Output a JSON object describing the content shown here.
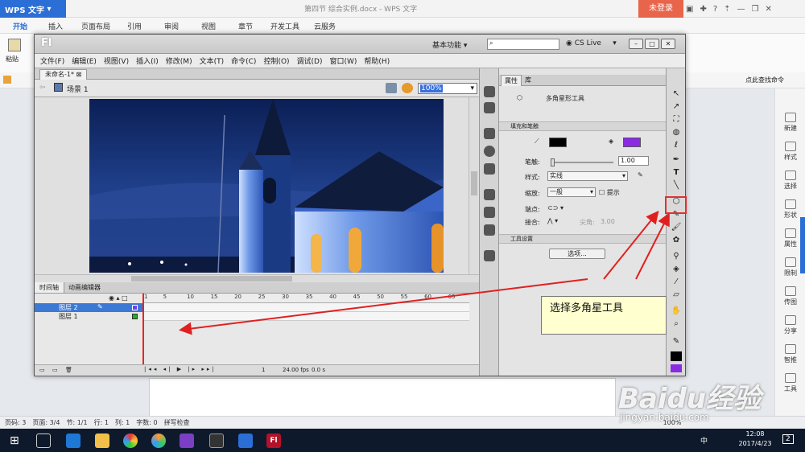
{
  "wps": {
    "app_name": "WPS 文字",
    "doc_title": "第四节  综合实例.docx - WPS 文字",
    "login": "未登录",
    "tabs": [
      "开始",
      "插入",
      "页面布局",
      "引用",
      "审阅",
      "视图",
      "章节",
      "开发工具",
      "云服务"
    ],
    "paste_label": "粘贴",
    "search_cmd": "点此查找命令",
    "sidebar": [
      "新建",
      "样式",
      "选择",
      "形状",
      "属性",
      "限制",
      "传图",
      "分享",
      "智推",
      "工具"
    ],
    "status": {
      "page": "页码: 3",
      "pages": "页面: 3/4",
      "section": "节: 1/1",
      "row": "行: 1",
      "col": "列: 1",
      "words": "字数: 0",
      "spell": "拼写检查",
      "zoom": "100%"
    }
  },
  "taskbar": {
    "time": "12:08",
    "date": "2017/4/23",
    "ime": "中",
    "notif": "2"
  },
  "flash": {
    "logo": "Fl",
    "workspace": "基本功能",
    "cslive": "CS Live",
    "menu": [
      "文件(F)",
      "编辑(E)",
      "视图(V)",
      "插入(I)",
      "修改(M)",
      "文本(T)",
      "命令(C)",
      "控制(O)",
      "调试(D)",
      "窗口(W)",
      "帮助(H)"
    ],
    "doc_tab": "未命名-1*",
    "scene": "场景 1",
    "zoom": "100%",
    "timeline_tabs": [
      "时间轴",
      "动画编辑器"
    ],
    "frame_ticks": [
      "1",
      "5",
      "10",
      "15",
      "20",
      "25",
      "30",
      "35",
      "40",
      "45",
      "50",
      "55",
      "60",
      "65"
    ],
    "layers": [
      {
        "name": "图层 2",
        "selected": true,
        "color": "#7b3df0"
      },
      {
        "name": "图层 1",
        "selected": false,
        "color": "#22b022"
      }
    ],
    "fps": "24.00 fps",
    "time": "0.0 s",
    "frame": "1"
  },
  "props": {
    "tabs": [
      "属性",
      "库"
    ],
    "tool_name": "多角星形工具",
    "fill_stroke_header": "填充和笔触",
    "stroke_color": "#000000",
    "fill_color": "#8a2be2",
    "stroke_label": "笔触:",
    "stroke_value": "1.00",
    "style_label": "样式:",
    "style_value": "实线",
    "scale_label": "缩放:",
    "scale_value": "一般",
    "hint_label": "提示",
    "cap_label": "端点:",
    "join_label": "接合:",
    "miter_label": "尖角:",
    "miter_value": "3.00",
    "tool_settings_header": "工具设置",
    "options_button": "选项..."
  },
  "callout": "选择多角星工具",
  "watermark": "Baidu经验",
  "watermark_url": "jingyan.baidu.com"
}
